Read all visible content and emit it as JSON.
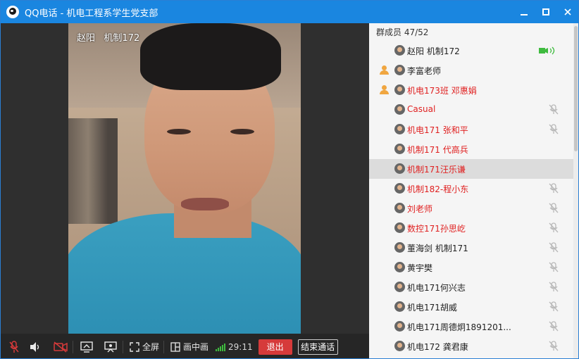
{
  "window": {
    "title": "QQ电话 - 机电工程系学生党支部",
    "controls": {
      "minimize": "▬",
      "maximize": "□",
      "close": "✕"
    }
  },
  "video": {
    "caller_overlay": "赵阳   机制172"
  },
  "toolbar": {
    "fullscreen_label": "全屏",
    "pip_label": "画中画",
    "timer": "29:11",
    "exit_label": "退出",
    "end_call_label": "结束通话",
    "signal_color": "#3fbb3f",
    "exit_color": "#d63a3a"
  },
  "panel": {
    "header": "群成员 47/52",
    "members": [
      {
        "name": "赵阳   机制172",
        "color": "dark",
        "admin": false,
        "status": "camera-on"
      },
      {
        "name": "李富老师",
        "color": "dark",
        "admin": true,
        "status": "none"
      },
      {
        "name": "机电173班 邓惠娟",
        "color": "red",
        "admin": true,
        "status": "none"
      },
      {
        "name": "Casual",
        "color": "red",
        "admin": false,
        "status": "mic-off"
      },
      {
        "name": "机电171 张和平",
        "color": "red",
        "admin": false,
        "status": "mic-off"
      },
      {
        "name": "机制171 代高兵",
        "color": "red",
        "admin": false,
        "status": "none"
      },
      {
        "name": "机制171汪乐谦",
        "color": "red",
        "admin": false,
        "status": "none",
        "selected": true
      },
      {
        "name": "机制182-程小东",
        "color": "red",
        "admin": false,
        "status": "mic-off"
      },
      {
        "name": "刘老师",
        "color": "red",
        "admin": false,
        "status": "mic-off"
      },
      {
        "name": "数控171孙思屹",
        "color": "red",
        "admin": false,
        "status": "mic-off"
      },
      {
        "name": "董海剑  机制171",
        "color": "dark",
        "admin": false,
        "status": "mic-off"
      },
      {
        "name": "黄宇樊",
        "color": "dark",
        "admin": false,
        "status": "mic-off"
      },
      {
        "name": "机电171何兴志",
        "color": "dark",
        "admin": false,
        "status": "mic-off"
      },
      {
        "name": "机电171胡威",
        "color": "dark",
        "admin": false,
        "status": "mic-off"
      },
      {
        "name": "机电171周德炯1891201...",
        "color": "dark",
        "admin": false,
        "status": "mic-off"
      },
      {
        "name": "机电172 龚君康",
        "color": "dark",
        "admin": false,
        "status": "mic-off"
      }
    ]
  }
}
